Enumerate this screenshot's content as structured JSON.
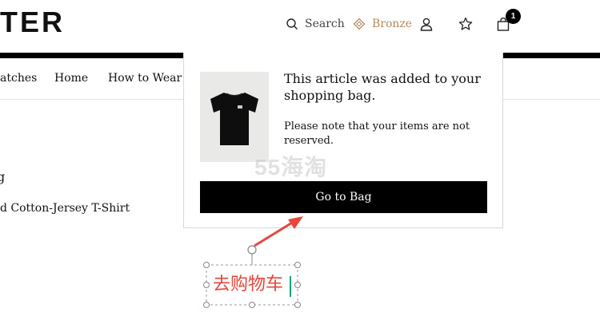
{
  "header": {
    "logo": "TER",
    "search_label": "Search",
    "bronze_label": "Bronze",
    "bag_count": "1",
    "icons": {
      "search": "search-icon",
      "bronze": "diamond-icon",
      "account": "person-icon",
      "wishlist": "star-icon",
      "bag": "shopping-bag-icon"
    }
  },
  "nav": {
    "items": [
      {
        "label": "atches"
      },
      {
        "label": "Home"
      },
      {
        "label": "How to Wear It"
      }
    ]
  },
  "product": {
    "fragment": "g",
    "name": "d Cotton-Jersey T-Shirt"
  },
  "popover": {
    "title": "This article was added to your shopping bag.",
    "note": "Please note that your items are not reserved.",
    "button": "Go to Bag"
  },
  "watermark": "55海淘",
  "annotation": {
    "text": "去购物车",
    "color": "#e8453c"
  },
  "colors": {
    "bronze": "#b38a5e",
    "brand": "#000000"
  }
}
